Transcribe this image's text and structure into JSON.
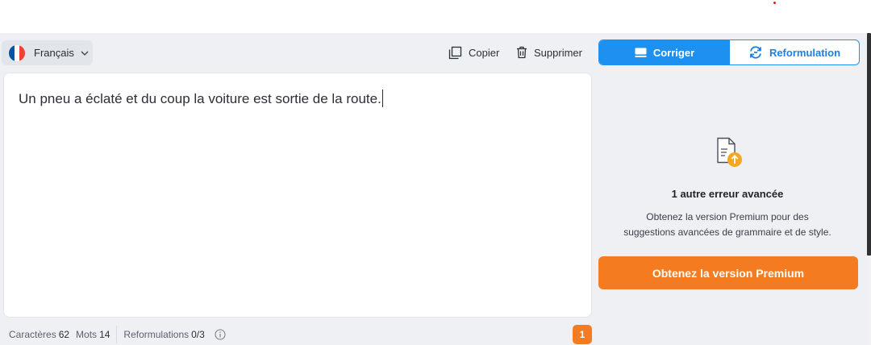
{
  "language": {
    "label": "Français",
    "flag_colors": [
      "#0055a4",
      "#ffffff",
      "#ef4135"
    ]
  },
  "toolbar": {
    "copy_label": "Copier",
    "delete_label": "Supprimer"
  },
  "modes": {
    "correct_label": "Corriger",
    "rephrase_label": "Reformulation",
    "active": "Corriger"
  },
  "editor": {
    "text": "Un pneu a éclaté et du coup la voiture est sortie de la route."
  },
  "stats": {
    "chars_label": "Caractères",
    "chars_value": "62",
    "words_label": "Mots",
    "words_value": "14",
    "rephrase_label": "Reformulations",
    "rephrase_value": "0/3"
  },
  "error_count": "1",
  "panel": {
    "title": "1 autre erreur avancée",
    "description_line1": "Obtenez la version Premium pour des",
    "description_line2": "suggestions avancées de grammaire et de style.",
    "cta_label": "Obtenez la version Premium"
  },
  "colors": {
    "primary": "#1e90f0",
    "accent": "#f47b20",
    "background": "#eef0f4"
  },
  "icons": [
    "chevron-down-icon",
    "copy-icon",
    "trash-icon",
    "keyboard-icon",
    "sync-icon",
    "document-upload-icon",
    "info-icon"
  ]
}
